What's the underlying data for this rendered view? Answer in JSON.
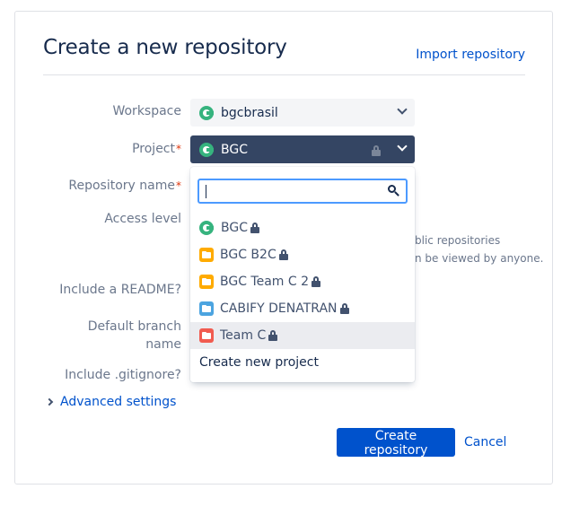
{
  "header": {
    "title": "Create a new repository",
    "import_link": "Import repository"
  },
  "form": {
    "workspace_label": "Workspace",
    "workspace_value": "bgcbrasil",
    "project_label": "Project",
    "project_value": "BGC",
    "repo_name_label": "Repository name",
    "access_label": "Access level",
    "access_note_line1": "blic repositories",
    "access_note_line2": "n be viewed by anyone.",
    "readme_label": "Include a README?",
    "branch_label_line1": "Default branch",
    "branch_label_line2": "name",
    "gitignore_label": "Include .gitignore?",
    "required_mark": "*"
  },
  "dropdown": {
    "search_value": "",
    "items": [
      {
        "label": "BGC",
        "icon": "bgc-logo-icon",
        "color": "#36b37e"
      },
      {
        "label": "BGC B2C",
        "icon": "folder-icon",
        "color": "#ffab00"
      },
      {
        "label": "BGC Team C 2",
        "icon": "folder-icon",
        "color": "#ffab00"
      },
      {
        "label": "CABIFY DENATRAN",
        "icon": "folder-icon",
        "color": "#4ca4e0"
      },
      {
        "label": "Team C",
        "icon": "folder-icon",
        "color": "#f15b50"
      }
    ],
    "create_new": "Create new project"
  },
  "advanced": {
    "label": "Advanced settings"
  },
  "actions": {
    "create": "Create repository",
    "cancel": "Cancel"
  },
  "colors": {
    "primary": "#0052cc",
    "selected_bg": "#344563",
    "focus_border": "#4c9aff"
  }
}
